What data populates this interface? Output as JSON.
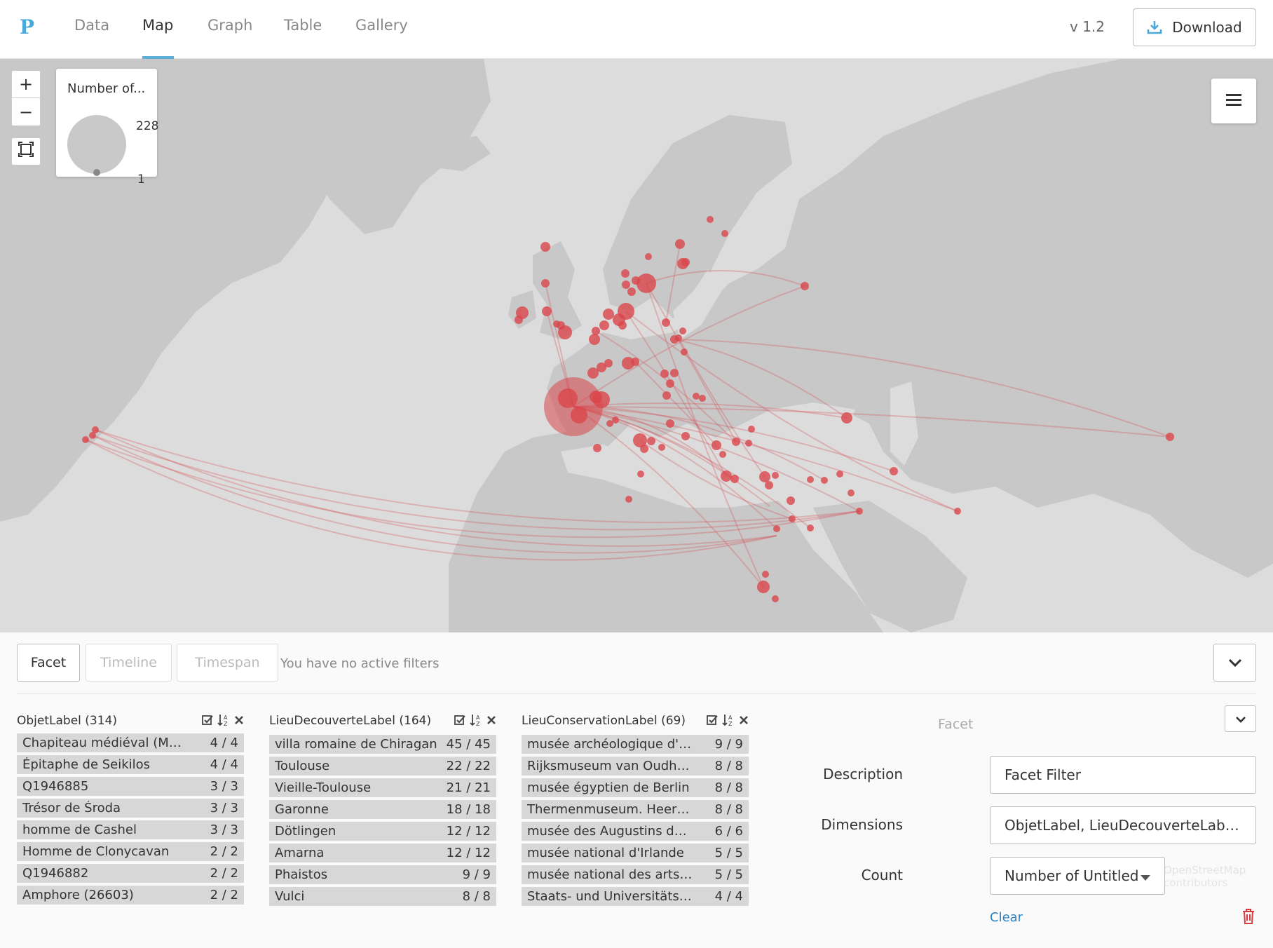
{
  "nav": {
    "logo": "P",
    "tabs": [
      {
        "label": "Data"
      },
      {
        "label": "Map"
      },
      {
        "label": "Graph"
      },
      {
        "label": "Table"
      },
      {
        "label": "Gallery"
      }
    ],
    "active_tab": "Map",
    "version": "v 1.2",
    "download_label": "Download",
    "accent_color": "#5ab0da"
  },
  "map": {
    "zoom_in": "+",
    "zoom_out": "−",
    "legend": {
      "title": "Number of...",
      "max": "228",
      "min": "1"
    },
    "marker_color": "#d9464b",
    "land_color": "#c8c8c8",
    "sea_color": "#dcdcdc"
  },
  "panel": {
    "tabs": {
      "facet": "Facet",
      "timeline": "Timeline",
      "timespan": "Timespan"
    },
    "filters_text": "You have no active filters",
    "facets": [
      {
        "title": "ObjetLabel (314)",
        "rows": [
          {
            "label": "Chapiteau médiéval (Mus...",
            "count": "4 / 4"
          },
          {
            "label": "Épitaphe de Seikilos",
            "count": "4 / 4"
          },
          {
            "label": "Q1946885",
            "count": "3 / 3"
          },
          {
            "label": "Trésor de Środa",
            "count": "3 / 3"
          },
          {
            "label": "homme de Cashel",
            "count": "3 / 3"
          },
          {
            "label": "Homme de Clonycavan",
            "count": "2 / 2"
          },
          {
            "label": "Q1946882",
            "count": "2 / 2"
          },
          {
            "label": "Amphore (26603)",
            "count": "2 / 2"
          }
        ]
      },
      {
        "title": "LieuDecouverteLabel (164)",
        "rows": [
          {
            "label": "villa romaine de Chiragan",
            "count": "45 / 45"
          },
          {
            "label": "Toulouse",
            "count": "22 / 22"
          },
          {
            "label": "Vieille-Toulouse",
            "count": "21 / 21"
          },
          {
            "label": "Garonne",
            "count": "18 / 18"
          },
          {
            "label": "Dötlingen",
            "count": "12 / 12"
          },
          {
            "label": "Amarna",
            "count": "12 / 12"
          },
          {
            "label": "Phaistos",
            "count": "9 / 9"
          },
          {
            "label": "Vulci",
            "count": "8 / 8"
          }
        ]
      },
      {
        "title": "LieuConservationLabel (69)",
        "rows": [
          {
            "label": "musée archéologique d'H...",
            "count": "9 / 9"
          },
          {
            "label": "Rijksmuseum van Oudhe...",
            "count": "8 / 8"
          },
          {
            "label": "musée égyptien de Berlin",
            "count": "8 / 8"
          },
          {
            "label": "Thermenmuseum. Heerle...",
            "count": "8 / 8"
          },
          {
            "label": "musée des Augustins de T...",
            "count": "6 / 6"
          },
          {
            "label": "musée national d'Irlande",
            "count": "5 / 5"
          },
          {
            "label": "musée national des arts a...",
            "count": "5 / 5"
          },
          {
            "label": "Staats- und Universitätsb...",
            "count": "4 / 4"
          }
        ]
      }
    ],
    "settings": {
      "heading": "Facet",
      "description_label": "Description",
      "description_value": "Facet Filter",
      "dimensions_label": "Dimensions",
      "dimensions_value": "ObjetLabel, LieuDecouverteLabel, L...",
      "count_label": "Count",
      "count_value": "Number of Untitled",
      "clear_label": "Clear"
    },
    "attribution": "OpenStreetMap contributors"
  }
}
